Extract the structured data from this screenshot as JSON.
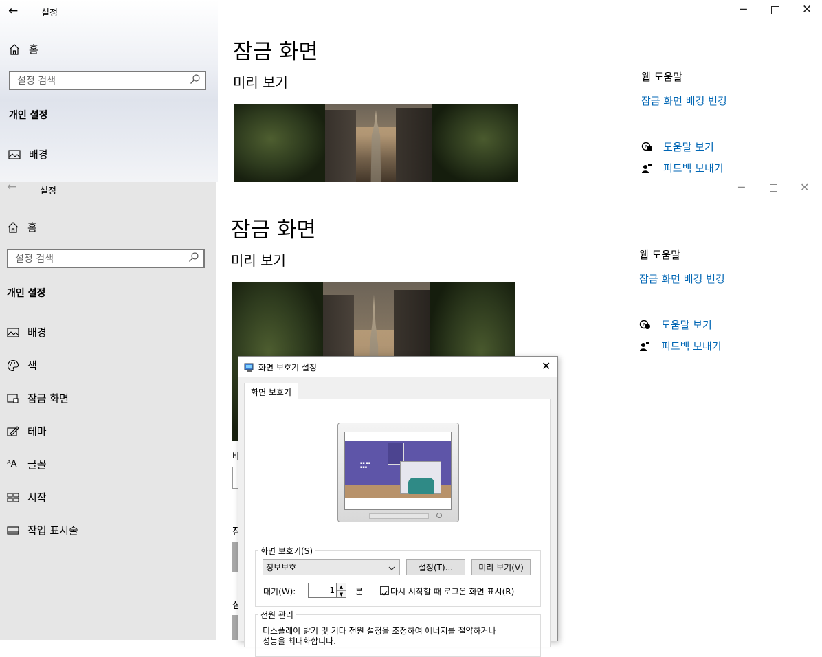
{
  "top_window": {
    "title": "설정",
    "sidebar": {
      "home": "홈",
      "search_placeholder": "설정 검색",
      "group": "개인 설정",
      "items": [
        {
          "label": "배경",
          "icon": "picture-icon"
        }
      ]
    },
    "main": {
      "page_title": "잠금 화면",
      "preview_label": "미리 보기"
    },
    "help": {
      "heading": "웹 도움말",
      "link_change_bg": "잠금 화면 배경 변경",
      "get_help": "도움말 보기",
      "feedback": "피드백 보내기"
    }
  },
  "mid_window": {
    "title": "설정",
    "sidebar": {
      "home": "홈",
      "search_placeholder": "설정 검색",
      "group": "개인 설정",
      "items": [
        {
          "label": "배경",
          "icon": "picture-icon"
        },
        {
          "label": "색",
          "icon": "palette-icon"
        },
        {
          "label": "잠금 화면",
          "icon": "lock-screen-icon"
        },
        {
          "label": "테마",
          "icon": "theme-icon"
        },
        {
          "label": "글꼴",
          "icon": "font-icon"
        },
        {
          "label": "시작",
          "icon": "start-icon"
        },
        {
          "label": "작업 표시줄",
          "icon": "taskbar-icon"
        }
      ]
    },
    "main": {
      "page_title": "잠금 화면",
      "preview_label": "미리 보기",
      "partial_labels": [
        "배",
        "잠",
        "잠"
      ]
    },
    "help": {
      "heading": "웹 도움말",
      "link_change_bg": "잠금 화면 배경 변경",
      "get_help": "도움말 보기",
      "feedback": "피드백 보내기"
    }
  },
  "dialog": {
    "title": "화면 보호기 설정",
    "tab": "화면 보호기",
    "screensaver_group": "화면 보호기(S)",
    "screensaver_value": "정보보호",
    "settings_button": "설정(T)...",
    "preview_button": "미리 보기(V)",
    "wait_label": "대기(W):",
    "wait_value": "1",
    "wait_unit": "분",
    "resume_logon_label": "다시 시작할 때 로그온 화면 표시(R)",
    "resume_logon_checked": true,
    "power_group": "전원 관리",
    "power_text_line1": "디스플레이 밝기 및 기타 전원 설정을 조정하여 에너지를 절약하거나",
    "power_text_line2": "성능을 최대화합니다."
  },
  "colors": {
    "link": "#0066b4",
    "mid_sidebar_bg": "#e6e6e6",
    "dialog_bg": "#f0f0f0"
  }
}
